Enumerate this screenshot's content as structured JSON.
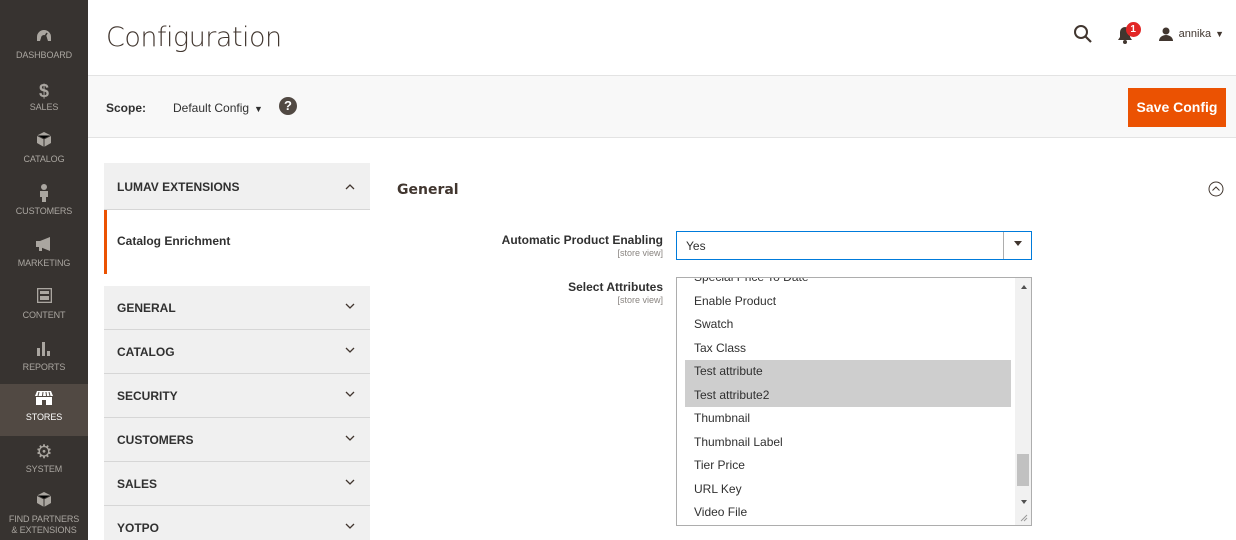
{
  "sidebar": {
    "items": [
      {
        "label": "DASHBOARD",
        "icon": "dashboard-icon"
      },
      {
        "label": "SALES",
        "icon": "dollar-icon"
      },
      {
        "label": "CATALOG",
        "icon": "box-icon"
      },
      {
        "label": "CUSTOMERS",
        "icon": "person-icon"
      },
      {
        "label": "MARKETING",
        "icon": "megaphone-icon"
      },
      {
        "label": "CONTENT",
        "icon": "layout-icon"
      },
      {
        "label": "REPORTS",
        "icon": "bar-chart-icon"
      },
      {
        "label": "STORES",
        "icon": "store-icon",
        "active": true
      },
      {
        "label": "SYSTEM",
        "icon": "gear-icon"
      },
      {
        "label_line1": "FIND PARTNERS",
        "label_line2": "& EXTENSIONS",
        "icon": "extensions-icon"
      }
    ]
  },
  "header": {
    "title": "Configuration",
    "notifications_count": "1",
    "username": "annika"
  },
  "scope": {
    "label": "Scope:",
    "value": "Default Config",
    "help": "?",
    "save_label": "Save Config"
  },
  "config_nav": {
    "sections": [
      {
        "title": "LUMAV EXTENSIONS",
        "expanded": true,
        "items": [
          "Catalog Enrichment"
        ]
      },
      {
        "title": "GENERAL"
      },
      {
        "title": "CATALOG"
      },
      {
        "title": "SECURITY"
      },
      {
        "title": "CUSTOMERS"
      },
      {
        "title": "SALES"
      },
      {
        "title": "YOTPO"
      }
    ]
  },
  "main": {
    "section_title": "General",
    "fields": {
      "enabling_label": "Automatic Product Enabling",
      "enabling_scope": "[store view]",
      "enabling_value": "Yes",
      "attributes_label": "Select Attributes",
      "attributes_scope": "[store view]",
      "attributes_options": [
        {
          "label": "Special Price To Date",
          "selected": false
        },
        {
          "label": "Enable Product",
          "selected": false
        },
        {
          "label": "Swatch",
          "selected": false
        },
        {
          "label": "Tax Class",
          "selected": false
        },
        {
          "label": "Test attribute",
          "selected": true
        },
        {
          "label": "Test attribute2",
          "selected": true
        },
        {
          "label": "Thumbnail",
          "selected": false
        },
        {
          "label": "Thumbnail Label",
          "selected": false
        },
        {
          "label": "Tier Price",
          "selected": false
        },
        {
          "label": "URL Key",
          "selected": false
        },
        {
          "label": "Video File",
          "selected": false
        }
      ]
    }
  },
  "colors": {
    "accent": "#eb5202",
    "sidebar_bg": "#373330",
    "sidebar_active": "#514943",
    "focus_border": "#007bdb"
  }
}
